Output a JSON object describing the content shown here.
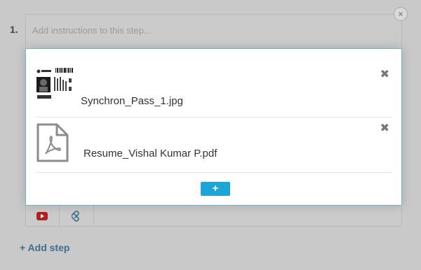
{
  "step": {
    "number": "1.",
    "instructions_placeholder": "Add instructions to this step...",
    "close_symbol": "×"
  },
  "attachments": [
    {
      "filename": "Synchron_Pass_1.jpg",
      "remove_symbol": "✖"
    },
    {
      "filename": "Resume_Vishal Kumar P.pdf",
      "remove_symbol": "✖"
    }
  ],
  "modal": {
    "add_button_label": "+"
  },
  "add_step": {
    "label": "+ Add step"
  },
  "colors": {
    "accent": "#1ea5d8",
    "youtube_red": "#b32020",
    "link": "#3e6d8e"
  },
  "icons": [
    "close-icon",
    "remove-icon",
    "pdf-icon",
    "youtube-icon",
    "paperclip-icon"
  ]
}
